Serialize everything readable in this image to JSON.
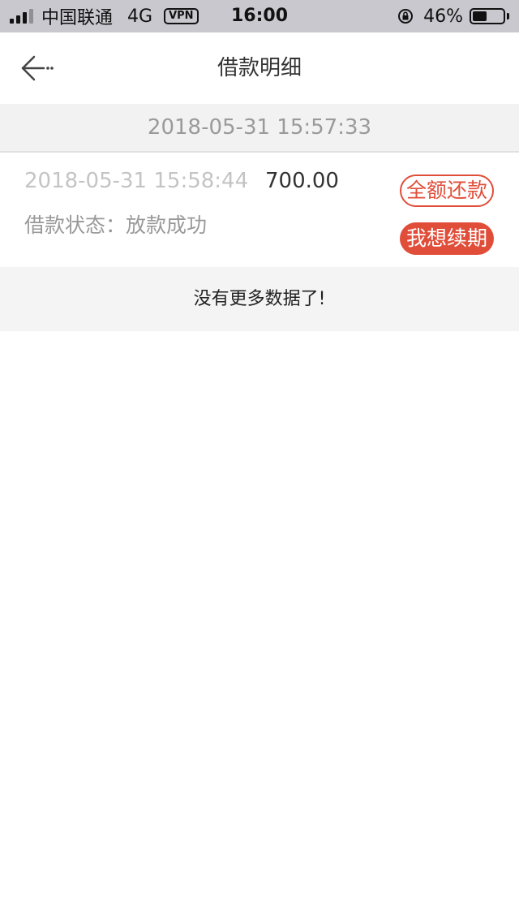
{
  "status_bar": {
    "carrier": "中国联通",
    "network": "4G",
    "vpn": "VPN",
    "time": "16:00",
    "battery": "46%",
    "battery_level": 0.46,
    "signal_bars_filled": 3,
    "signal_bars_total": 4
  },
  "nav": {
    "title": "借款明细",
    "back_icon": "back-arrow-icon"
  },
  "list": {
    "date_header": "2018-05-31 15:57:33",
    "records": [
      {
        "time": "2018-05-31 15:58:44",
        "amount": "700.00",
        "status": "借款状态：放款成功",
        "repay_label": "全额还款",
        "extend_label": "我想续期"
      }
    ],
    "no_more": "没有更多数据了!"
  },
  "colors": {
    "accent": "#e04e3a",
    "status_bar_bg": "#c8c8ce",
    "section_bg": "#f2f2f2"
  }
}
